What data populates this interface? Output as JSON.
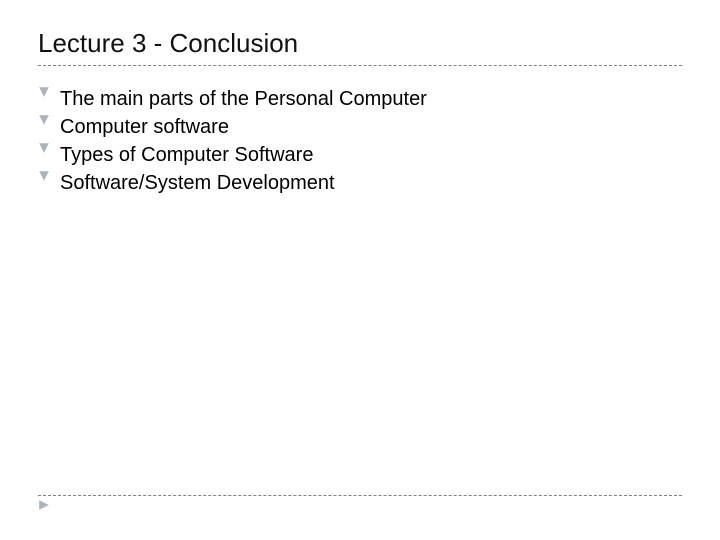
{
  "title": "Lecture 3 - Conclusion",
  "bullets": [
    "The main parts of the Personal Computer",
    "Computer software",
    "Types of Computer Software",
    "Software/System Development"
  ]
}
